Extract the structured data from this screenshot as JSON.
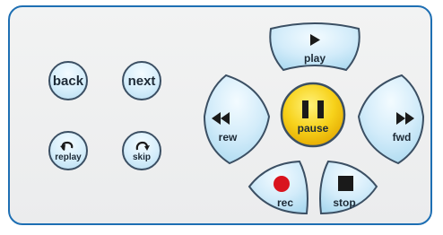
{
  "panel": {
    "border_color": "#1e6fb3",
    "background": "#efeff0"
  },
  "left_buttons": {
    "back": {
      "label": "back"
    },
    "next": {
      "label": "next"
    },
    "replay": {
      "label": "replay",
      "icon": "replay-arrow-icon"
    },
    "skip": {
      "label": "skip",
      "icon": "skip-arrow-icon"
    }
  },
  "cluster": {
    "play": {
      "label": "play",
      "icon": "play-icon"
    },
    "rew": {
      "label": "rew",
      "icon": "rewind-icon"
    },
    "pause": {
      "label": "pause",
      "icon": "pause-icon"
    },
    "fwd": {
      "label": "fwd",
      "icon": "fast-forward-icon"
    },
    "rec": {
      "label": "rec",
      "icon": "record-icon"
    },
    "stop": {
      "label": "stop",
      "icon": "stop-icon"
    }
  },
  "colors": {
    "button_blue": "#cfeaf9",
    "button_outline": "#3b4f63",
    "pause_gold": "#f3c400",
    "record_red": "#d9141e"
  }
}
